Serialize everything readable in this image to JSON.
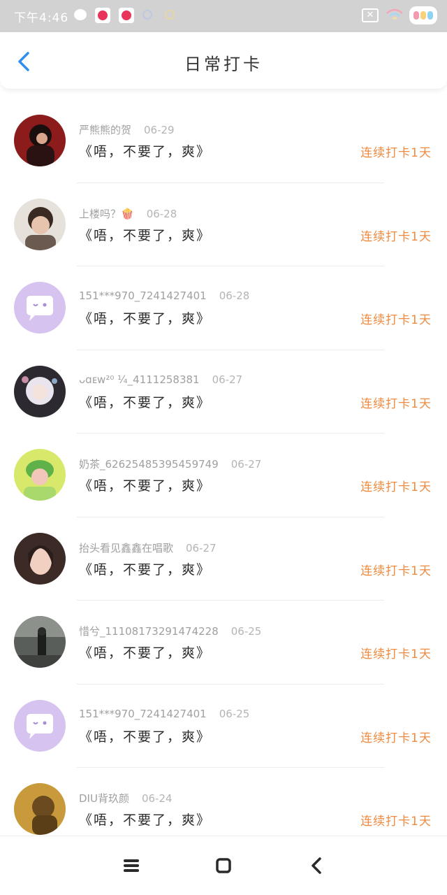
{
  "status_bar": {
    "time": "下午4:46",
    "box_icon_glyph": "✕"
  },
  "header": {
    "title": "日常打卡",
    "back_icon": "chevron-left-icon",
    "accent_color": "#2f8ef0"
  },
  "entries": [
    {
      "name": "严熊熊的贺",
      "date": "06-29",
      "message": "《唔，不要了，爽》",
      "streak": "连续打卡1天",
      "avatar": "photo-dark-red"
    },
    {
      "name": "上楼吗？🍿",
      "date": "06-28",
      "message": "《唔，不要了，爽》",
      "streak": "连续打卡1天",
      "avatar": "photo-boy"
    },
    {
      "name": "151***970_7241427401",
      "date": "06-28",
      "message": "《唔，不要了，爽》",
      "streak": "连续打卡1天",
      "avatar": "default-chat"
    },
    {
      "name": "ᴗɑᴇw²⁰ ¼_4111258381",
      "date": "06-27",
      "message": "《唔，不要了，爽》",
      "streak": "连续打卡1天",
      "avatar": "photo-anime"
    },
    {
      "name": "奶茶_626254853954597​49",
      "date": "06-27",
      "message": "《唔，不要了，爽》",
      "streak": "连续打卡1天",
      "avatar": "photo-green"
    },
    {
      "name": "抬头看见鑫鑫在唱歌",
      "date": "06-27",
      "message": "《唔，不要了，爽》",
      "streak": "连续打卡1天",
      "avatar": "photo-girl"
    },
    {
      "name": "惜兮_1110817329147​4228",
      "date": "06-25",
      "message": "《唔，不要了，爽》",
      "streak": "连续打卡1天",
      "avatar": "photo-street"
    },
    {
      "name": "151***970_7241427401",
      "date": "06-25",
      "message": "《唔，不要了，爽》",
      "streak": "连续打卡1天",
      "avatar": "default-chat"
    },
    {
      "name": "DIU背玖颜",
      "date": "06-24",
      "message": "《唔，不要了，爽》",
      "streak": "连续打卡1天",
      "avatar": "photo-gold"
    }
  ],
  "colors": {
    "streak": "#ef8a3f",
    "name": "#a0a0a0",
    "message": "#2c2c2c"
  },
  "nav": {
    "menu_icon": "menu-icon",
    "home_icon": "square-home-icon",
    "back_icon": "chevron-left-icon"
  }
}
